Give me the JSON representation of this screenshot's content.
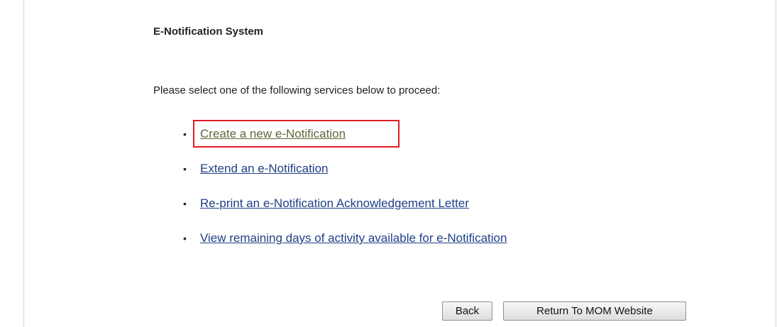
{
  "page": {
    "title": "E-Notification System",
    "intro": "Please select one of the following services below to proceed:"
  },
  "services": [
    {
      "label": "Create a new e-Notification",
      "highlighted": true
    },
    {
      "label": "Extend an e-Notification",
      "highlighted": false
    },
    {
      "label": "Re-print an e-Notification Acknowledgement Letter",
      "highlighted": false
    },
    {
      "label": "View remaining days of activity available for e-Notification",
      "highlighted": false
    }
  ],
  "buttons": {
    "back": "Back",
    "return": "Return To MOM Website"
  },
  "colors": {
    "link": "#1f3f86",
    "highlight_border": "#e01b24"
  }
}
